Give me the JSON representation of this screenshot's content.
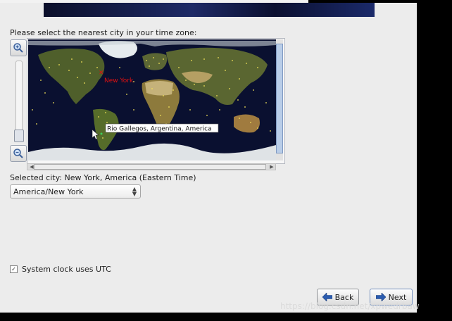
{
  "instruction": "Please select the nearest city in your time zone:",
  "map": {
    "marked_city": "New York",
    "hover_label": "Rio Gallegos, Argentina, America",
    "marker_color": "#e01010"
  },
  "zoom": {
    "in_icon": "zoom-in-icon",
    "out_icon": "zoom-out-icon"
  },
  "selected_city_text": "Selected city: New York, America (Eastern Time)",
  "timezone_select": {
    "value": "America/New York"
  },
  "utc": {
    "label": "System clock uses UTC",
    "checked": true
  },
  "buttons": {
    "back": "Back",
    "next": "Next"
  },
  "watermark": "https://blog.csdn.net/xpwedrbaw"
}
